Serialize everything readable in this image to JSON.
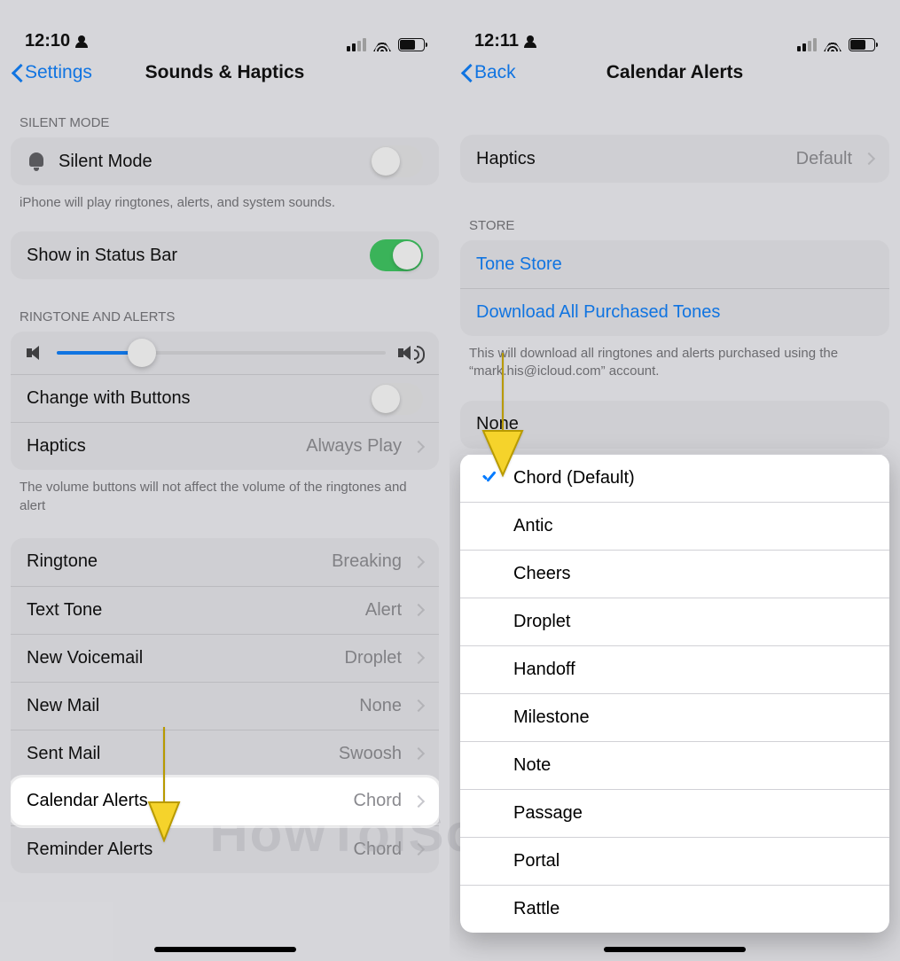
{
  "left": {
    "time": "12:10",
    "back_label": "Settings",
    "title": "Sounds & Haptics",
    "silent_header": "SILENT MODE",
    "silent_label": "Silent Mode",
    "silent_footer": "iPhone will play ringtones, alerts, and system sounds.",
    "statusbar_label": "Show in Status Bar",
    "ringtone_header": "RINGTONE AND ALERTS",
    "change_buttons_label": "Change with Buttons",
    "haptics_label": "Haptics",
    "haptics_value": "Always Play",
    "volume_footer": "The volume buttons will not affect the volume of the ringtones and alert",
    "sounds": [
      {
        "label": "Ringtone",
        "value": "Breaking"
      },
      {
        "label": "Text Tone",
        "value": "Alert"
      },
      {
        "label": "New Voicemail",
        "value": "Droplet"
      },
      {
        "label": "New Mail",
        "value": "None"
      },
      {
        "label": "Sent Mail",
        "value": "Swoosh"
      },
      {
        "label": "Calendar Alerts",
        "value": "Chord"
      },
      {
        "label": "Reminder Alerts",
        "value": "Chord"
      }
    ]
  },
  "right": {
    "time": "12:11",
    "back_label": "Back",
    "title": "Calendar Alerts",
    "haptics_label": "Haptics",
    "haptics_value": "Default",
    "store_header": "STORE",
    "tone_store": "Tone Store",
    "download_all": "Download All Purchased Tones",
    "store_footer": "This will download all ringtones and alerts purchased using the “mark.his@icloud.com” account.",
    "none_label": "None",
    "tones": [
      {
        "label": "Chord (Default)",
        "checked": true
      },
      {
        "label": "Antic",
        "checked": false
      },
      {
        "label": "Cheers",
        "checked": false
      },
      {
        "label": "Droplet",
        "checked": false
      },
      {
        "label": "Handoff",
        "checked": false
      },
      {
        "label": "Milestone",
        "checked": false
      },
      {
        "label": "Note",
        "checked": false
      },
      {
        "label": "Passage",
        "checked": false
      },
      {
        "label": "Portal",
        "checked": false
      },
      {
        "label": "Rattle",
        "checked": false
      }
    ]
  },
  "watermark": "HowToiSolve.com"
}
